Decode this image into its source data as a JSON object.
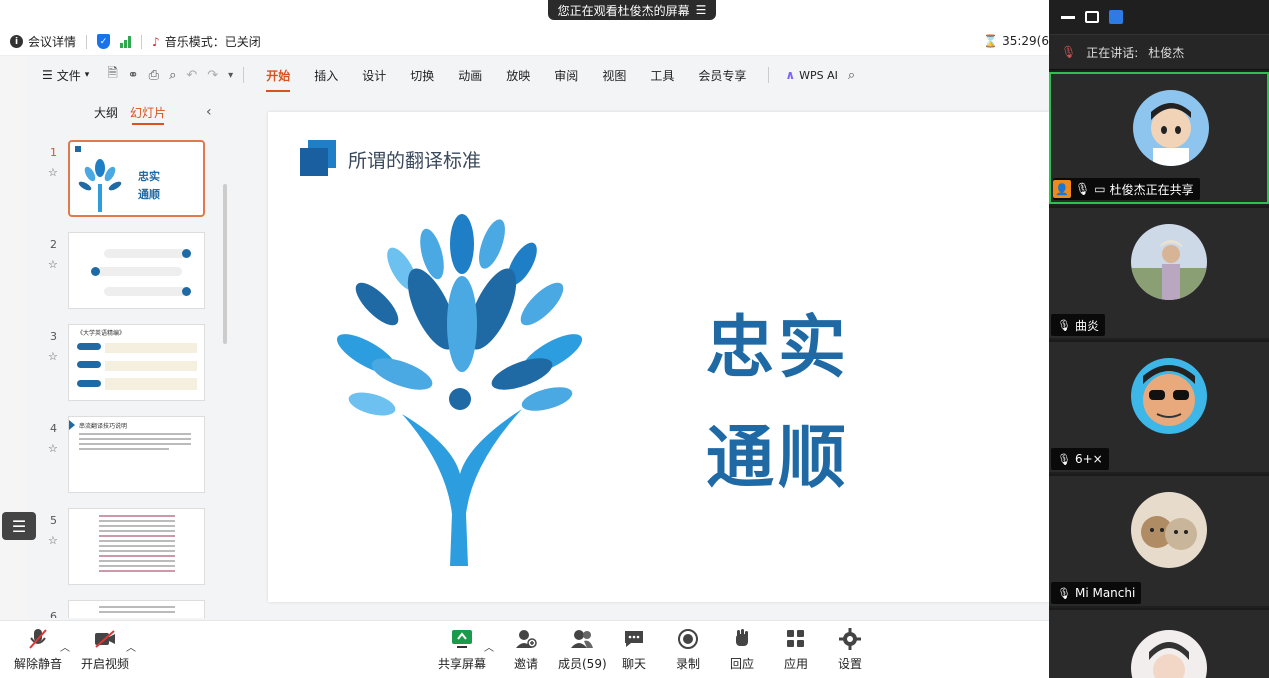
{
  "share_banner": {
    "text": "您正在观看杜俊杰的屏幕",
    "menu_icon": "list-icon"
  },
  "info_bar": {
    "meeting_details": "会议详情",
    "music_mode": "音乐模式：已关闭",
    "timer": "35:29(6"
  },
  "ribbon": {
    "file_menu": "文件",
    "tabs": [
      "开始",
      "插入",
      "设计",
      "切换",
      "动画",
      "放映",
      "审阅",
      "视图",
      "工具",
      "会员专享"
    ],
    "active_tab": "开始",
    "ai_label": "WPS AI"
  },
  "side_panel": {
    "tabs": [
      "大纲",
      "幻灯片"
    ],
    "active_tab": "幻灯片",
    "slide_numbers": [
      "1",
      "2",
      "3",
      "4",
      "5",
      "6"
    ]
  },
  "slide": {
    "title": "所谓的翻译标准",
    "line1": "忠实",
    "line2": "通顺"
  },
  "thumbs": {
    "t1_line1": "忠实",
    "t1_line2": "通顺",
    "t3_title": "《大学英语精编》",
    "t4_title": "串流翻译技巧说明"
  },
  "panel": {
    "speaking_label": "正在讲话:",
    "speaking_name": "杜俊杰",
    "participants": [
      {
        "name": "杜俊杰正在共享",
        "avatar": "cartoon-boy"
      },
      {
        "name": "曲炎",
        "avatar": "woman-photo"
      },
      {
        "name": "6+×",
        "avatar": "cartoon-sunglasses"
      },
      {
        "name": "Mi Manchi",
        "avatar": "cats-photo"
      },
      {
        "name": "",
        "avatar": "man-photo"
      }
    ]
  },
  "bottom_bar": {
    "unmute": "解除静音",
    "start_video": "开启视频",
    "share_screen": "共享屏幕",
    "invite": "邀请",
    "members": "成员(59)",
    "chat": "聊天",
    "record": "录制",
    "react": "回应",
    "apps": "应用",
    "settings": "设置"
  },
  "colors": {
    "accent": "#d9531e",
    "slide_blue": "#1f6aa5",
    "active_speaker": "#31c04f",
    "panel_bg": "#1f1f1f"
  }
}
